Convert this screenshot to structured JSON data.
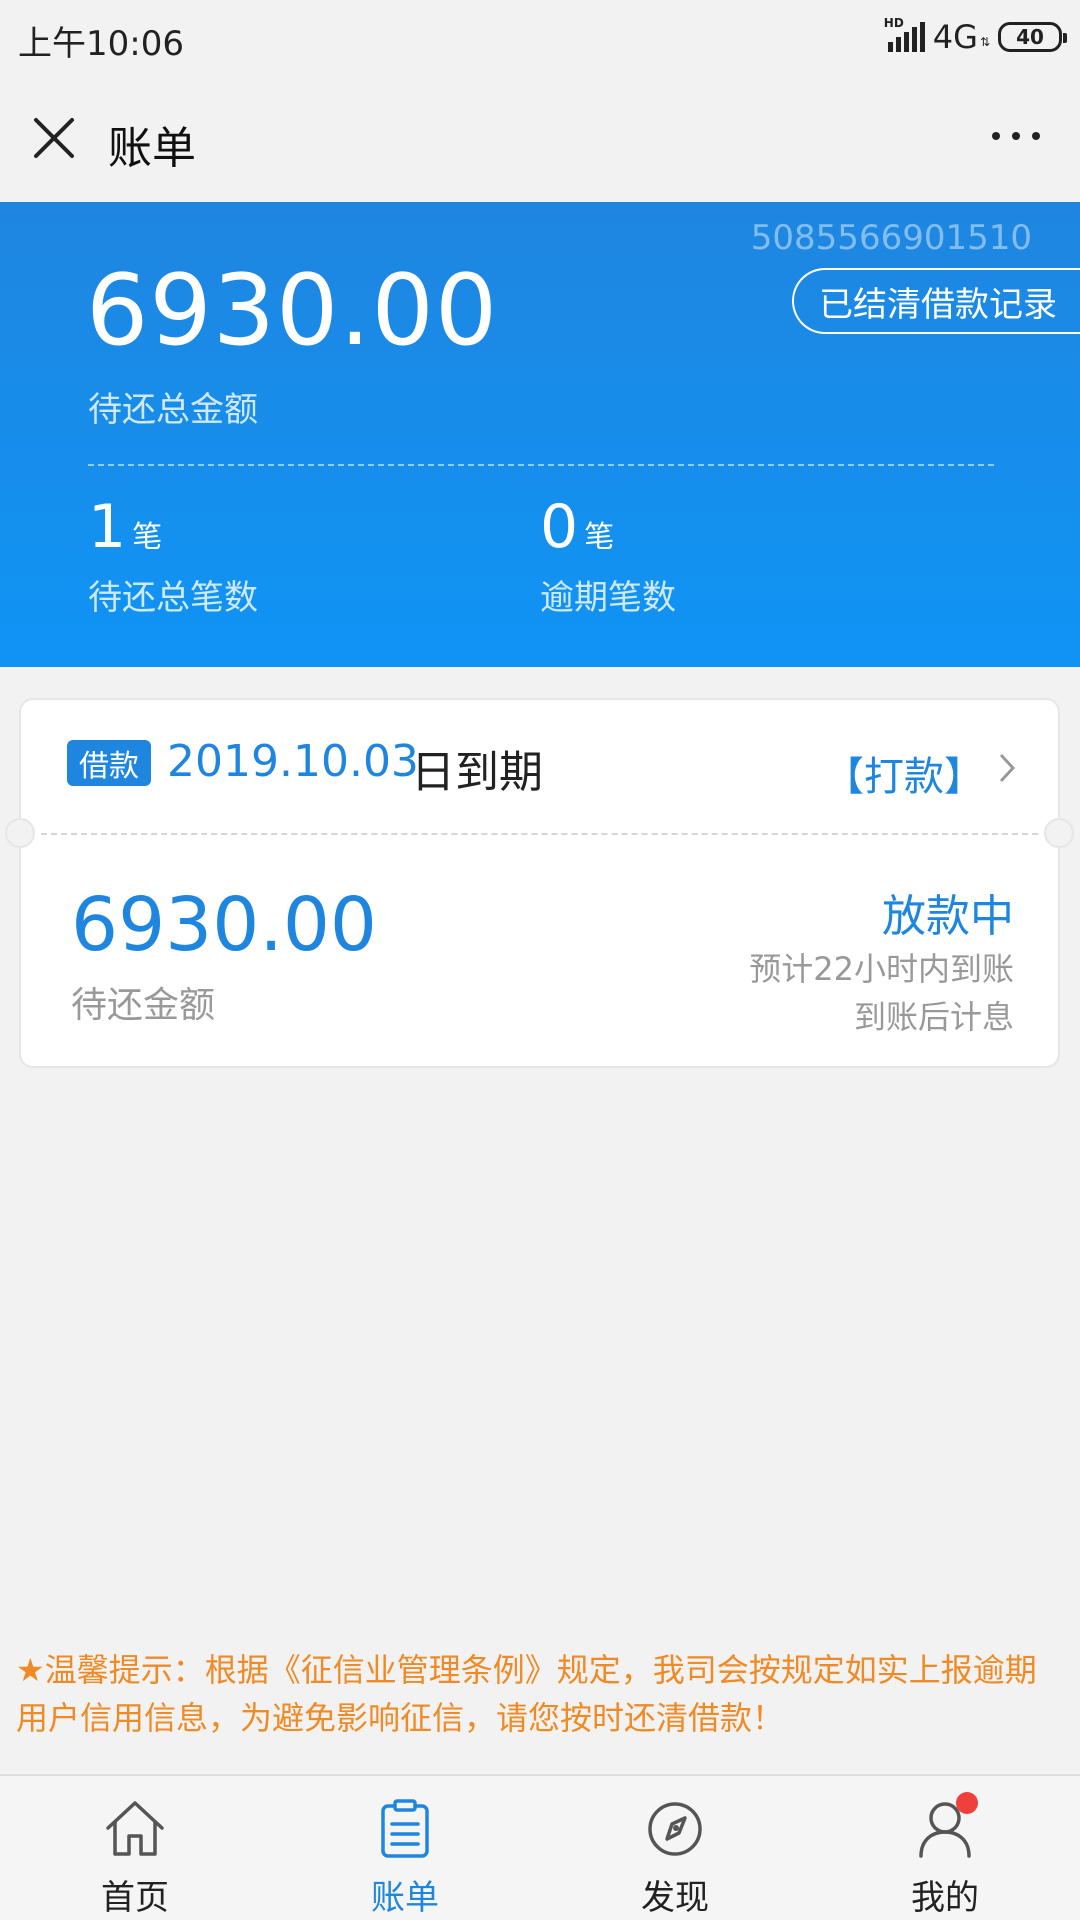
{
  "status_bar": {
    "time": "上午10:06",
    "network": "4G",
    "hd": "HD",
    "battery": "40"
  },
  "header": {
    "title": "账单"
  },
  "summary": {
    "account_no": "5085566901510",
    "settled_button": "已结清借款记录",
    "total_amount": "6930.00",
    "total_label": "待还总金额",
    "pending_count": "1",
    "pending_unit": "笔",
    "pending_label": "待还总笔数",
    "overdue_count": "0",
    "overdue_unit": "笔",
    "overdue_label": "逾期笔数"
  },
  "loan_card": {
    "tag": "借款",
    "due_date": "2019.10.03",
    "due_suffix": "日到期",
    "pay_link": "【打款】",
    "amount": "6930.00",
    "amount_label": "待还金额",
    "status": "放款中",
    "note_eta": "预计22小时内到账",
    "note_interest": "到账后计息"
  },
  "tip": {
    "text": "★温馨提示：根据《征信业管理条例》规定，我司会按规定如实上报逾期用户信用信息，为避免影响征信，请您按时还清借款！"
  },
  "bottom_nav": {
    "items": [
      {
        "label": "首页",
        "icon": "home-icon"
      },
      {
        "label": "账单",
        "icon": "bill-icon"
      },
      {
        "label": "发现",
        "icon": "compass-icon"
      },
      {
        "label": "我的",
        "icon": "user-icon"
      }
    ],
    "active_index": 1
  },
  "colors": {
    "brand_blue": "#1f86e0",
    "tip_orange": "#f08a24",
    "badge_red": "#f0403c"
  }
}
